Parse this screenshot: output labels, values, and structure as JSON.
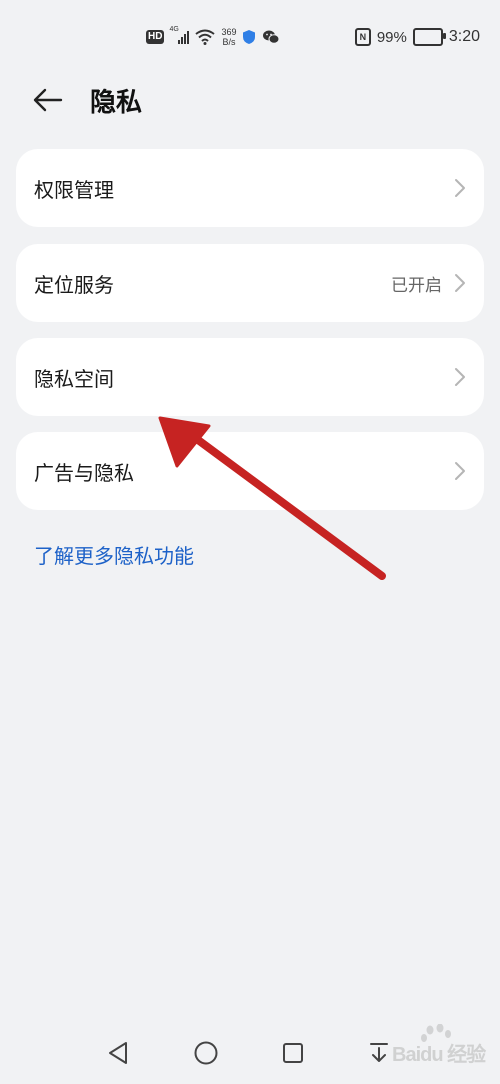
{
  "status_bar": {
    "hd_badge": "HD",
    "network_type": "4G",
    "net_speed_value": "369",
    "net_speed_unit": "B/s",
    "nfc_label": "N",
    "battery_percent": "99%",
    "time": "3:20"
  },
  "header": {
    "title": "隐私"
  },
  "settings": [
    {
      "label": "权限管理",
      "value": ""
    },
    {
      "label": "定位服务",
      "value": "已开启"
    },
    {
      "label": "隐私空间",
      "value": ""
    },
    {
      "label": "广告与隐私",
      "value": ""
    }
  ],
  "more_link": "了解更多隐私功能",
  "watermark": {
    "text": "Baidu 经验"
  },
  "colors": {
    "background": "#f1f2f4",
    "card": "#ffffff",
    "link": "#1e62c8",
    "annotation_arrow": "#c62322"
  }
}
